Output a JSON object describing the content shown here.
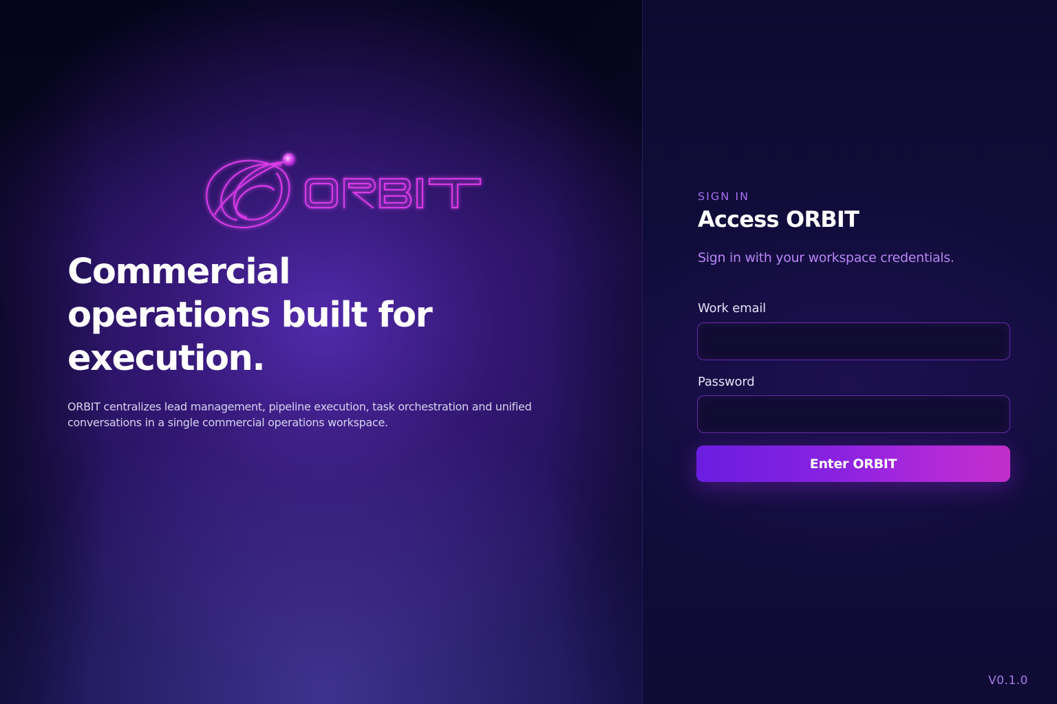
{
  "brand": {
    "name": "ORBIT",
    "logo_icon": "orbit-ring-icon",
    "accent_color": "#d03ae8"
  },
  "hero": {
    "title": "Commercial operations built for execution.",
    "description": "ORBIT centralizes lead management, pipeline execution, task orchestration and unified conversations in a single commercial operations workspace."
  },
  "signin": {
    "eyebrow": "SIGN IN",
    "title": "Access ORBIT",
    "subtitle": "Sign in with your workspace credentials.",
    "email": {
      "label": "Work email",
      "value": "",
      "placeholder": ""
    },
    "password": {
      "label": "Password",
      "value": "",
      "placeholder": ""
    },
    "submit_label": "Enter ORBIT"
  },
  "version": "V0.1.0",
  "colors": {
    "primary": "#8a22e0",
    "button_end": "#c22ec8",
    "eyebrow": "#a86ef0",
    "background": "#0d0b30"
  }
}
